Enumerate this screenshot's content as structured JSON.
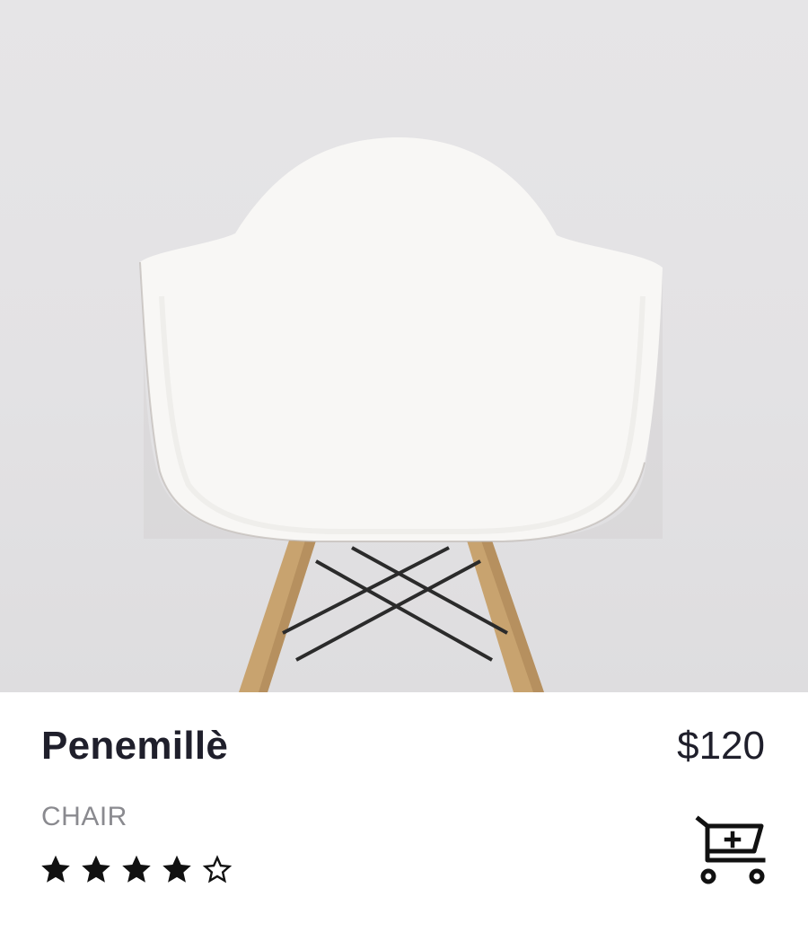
{
  "product": {
    "name": "Penemillè",
    "price": "$120",
    "category": "CHAIR",
    "rating": {
      "value": 4,
      "max": 5
    }
  },
  "icons": {
    "cart": "add-to-cart-icon",
    "star_filled": "star-filled-icon",
    "star_empty": "star-outline-icon"
  },
  "colors": {
    "title": "#1f1f2b",
    "category": "#8a8a8f",
    "photo_background": "#e4e3e5"
  }
}
